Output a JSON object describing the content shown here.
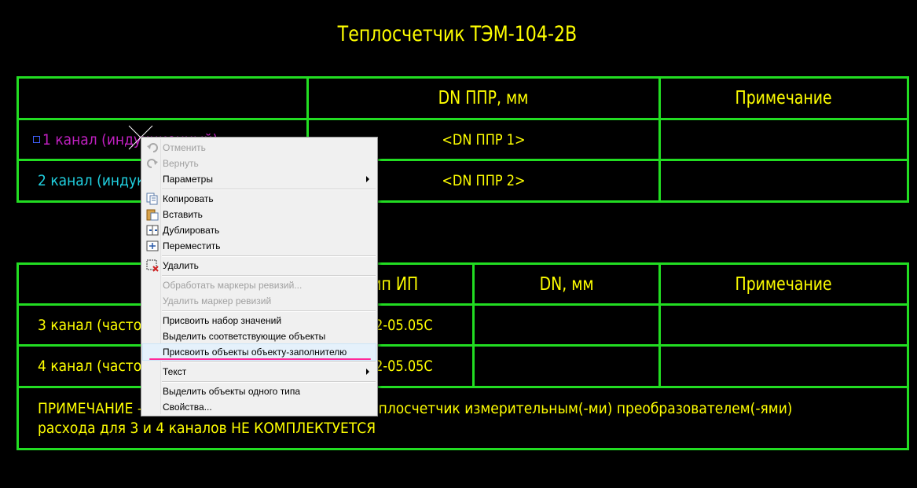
{
  "title": "Теплосчетчик ТЭМ-104-2В",
  "table1": {
    "headers": [
      "",
      "DN ППР, мм",
      "Примечание"
    ],
    "rows": [
      {
        "label": "1 канал (индукционный)",
        "value": "<DN ППР 1>",
        "note": ""
      },
      {
        "label": "2 канал (индукционный)",
        "value": "<DN ППР 2>",
        "note": ""
      }
    ]
  },
  "table2": {
    "headers": [
      "",
      "Тип ИП",
      "DN, мм",
      "Примечание"
    ],
    "rows": [
      {
        "label": "3 канал (частотный)",
        "type": "ВПС2-05.05С",
        "dn": "",
        "note": ""
      },
      {
        "label": "4 канал (частотный)",
        "type": "ВПС2-05.05С",
        "dn": "",
        "note": ""
      }
    ],
    "footnote_line1": "ПРИМЕЧАНИЕ – теплосчетчик комплектуется теплосчетчик измерительным(-ми) преобразователем(-ями)",
    "footnote_line2": "расхода для 3 и 4 каналов НЕ КОМПЛЕКТУЕТСЯ"
  },
  "context_menu": {
    "items": [
      {
        "label": "Отменить",
        "icon": "undo-icon",
        "disabled": true
      },
      {
        "label": "Вернуть",
        "icon": "redo-icon",
        "disabled": true
      },
      {
        "label": "Параметры",
        "icon": "",
        "submenu": true
      },
      {
        "label": "Копировать",
        "icon": "copy-icon"
      },
      {
        "label": "Вставить",
        "icon": "paste-icon"
      },
      {
        "label": "Дублировать",
        "icon": "duplicate-icon"
      },
      {
        "label": "Переместить",
        "icon": "move-icon"
      },
      {
        "label": "Удалить",
        "icon": "delete-icon"
      },
      {
        "label": "Обработать маркеры ревизий...",
        "icon": "",
        "disabled": true
      },
      {
        "label": "Удалить маркер ревизий",
        "icon": "",
        "disabled": true
      },
      {
        "label": "Присвоить набор значений",
        "icon": ""
      },
      {
        "label": "Выделить соответствующие объекты",
        "icon": ""
      },
      {
        "label": "Присвоить объекты объекту-заполнителю",
        "icon": "",
        "highlighted": true
      },
      {
        "label": "Текст",
        "icon": "",
        "submenu": true
      },
      {
        "label": "Выделить объекты одного типа",
        "icon": ""
      },
      {
        "label": "Свойства...",
        "icon": ""
      }
    ]
  },
  "colors": {
    "grid": "#22dd22",
    "text": "#ffff00",
    "magenta": "#c020c0",
    "cyan": "#20d0e0",
    "annotation": "#ff2a9a"
  }
}
